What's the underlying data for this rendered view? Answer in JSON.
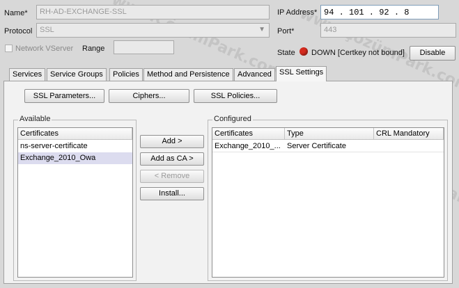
{
  "form": {
    "name_label": "Name*",
    "name_value": "RH-AD-EXCHANGE-SSL",
    "protocol_label": "Protocol",
    "protocol_value": "SSL",
    "network_vserver_label": "Network VServer",
    "range_label": "Range",
    "range_value": "",
    "ip_label": "IP Address*",
    "ip_value": "94  . 101 . 92  . 8",
    "port_label": "Port*",
    "port_value": "443",
    "state_label": "State",
    "state_value": "DOWN [Certkey not bound]",
    "disable_label": "Disable"
  },
  "tabs": [
    "Services",
    "Service Groups",
    "Policies",
    "Method and Persistence",
    "Advanced",
    "SSL Settings"
  ],
  "ssl_settings": {
    "ssl_parameters_label": "SSL Parameters...",
    "ciphers_label": "Ciphers...",
    "ssl_policies_label": "SSL Policies...",
    "available_title": "Available",
    "available_header": "Certificates",
    "available_items": [
      "ns-server-certificate",
      "Exchange_2010_Owa"
    ],
    "add_label": "Add >",
    "add_as_ca_label": "Add as CA >",
    "remove_label": "< Remove",
    "install_label": "Install...",
    "configured_title": "Configured",
    "configured_headers": [
      "Certificates",
      "Type",
      "CRL Mandatory"
    ],
    "configured_rows": [
      [
        "Exchange_2010_...",
        "Server Certificate",
        ""
      ]
    ]
  },
  "colors": {
    "state_icon": "#d42b1e",
    "selected_row": "#dcdcef"
  },
  "watermark": "www.ÇözümPark.com"
}
